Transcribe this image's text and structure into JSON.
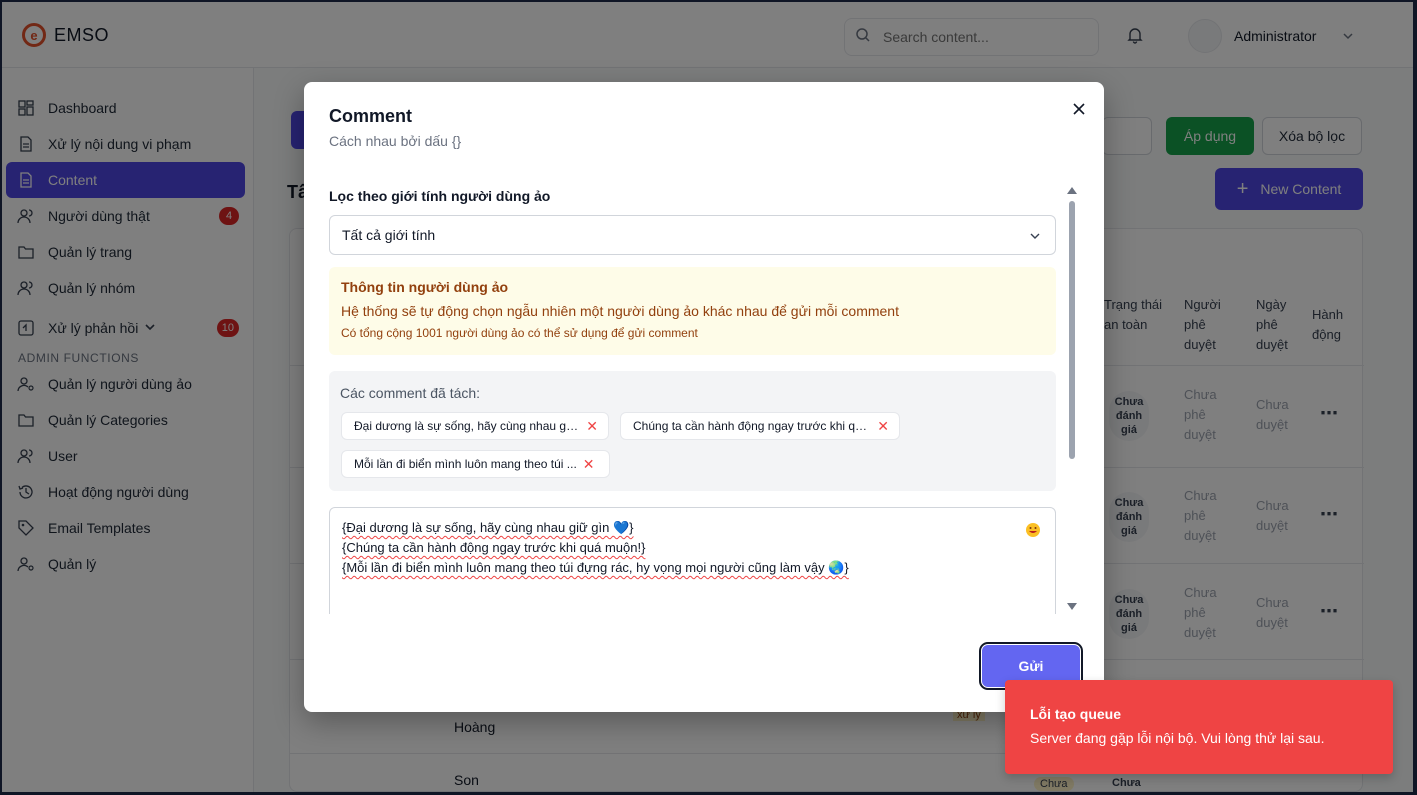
{
  "app": {
    "brand": "EMSO",
    "brand_color": "#e4502a"
  },
  "header": {
    "search_placeholder": "Search content...",
    "user_name": "Administrator"
  },
  "sidebar": {
    "items": [
      {
        "label": "Dashboard",
        "icon": "grid-icon"
      },
      {
        "label": "Xử lý nội dung vi phạm",
        "icon": "document-icon"
      },
      {
        "label": "Content",
        "icon": "document-icon",
        "active": true
      },
      {
        "label": "Người dùng thật",
        "icon": "users-icon",
        "badge": "4"
      },
      {
        "label": "Quản lý trang",
        "icon": "folder-icon"
      },
      {
        "label": "Quản lý nhóm",
        "icon": "users-icon"
      },
      {
        "label": "Xử lý phản hồi",
        "icon": "plus-square-icon",
        "badge": "10"
      }
    ],
    "section_label": "ADMIN FUNCTIONS",
    "admin_items": [
      {
        "label": "Quản lý người dùng ảo",
        "icon": "user-cog-icon"
      },
      {
        "label": "Quản lý Categories",
        "icon": "folder-icon"
      },
      {
        "label": "User",
        "icon": "users-icon"
      },
      {
        "label": "Hoạt động người dùng",
        "icon": "history-icon"
      },
      {
        "label": "Email Templates",
        "icon": "tag-icon"
      },
      {
        "label": "Quản lý",
        "icon": "user-cog-icon"
      }
    ],
    "accent": "#4f46e5"
  },
  "background": {
    "title_partial": "Tấ",
    "apply_label": "Áp dụng",
    "clear_label": "Xóa bộ lọc",
    "new_content_label": "New Content",
    "columns": [
      "Trạng thái an toàn",
      "Người phê duyệt",
      "Ngày phê duyệt",
      "Hành động"
    ],
    "pill_label": "Chưa đánh giá",
    "approver_label": "Chưa phê duyệt",
    "date_label": "Chưa duyệt",
    "row_names": [
      "Hoàng",
      "Son"
    ],
    "partial_tag": "xử lý",
    "partial_pill": "Chưa"
  },
  "modal": {
    "title": "Comment",
    "subtitle": "Cách nhau bởi dấu {}",
    "gender_label": "Lọc theo giới tính người dùng ảo",
    "gender_value": "Tất cả giới tính",
    "info_title": "Thông tin người dùng ảo",
    "info_line1": "Hệ thống sẽ tự động chọn ngẫu nhiên một người dùng ảo khác nhau để gửi mỗi comment",
    "info_line2": "Có tổng cộng 1001 người dùng ảo có thể sử dụng để gửi comment",
    "chips_label": "Các comment đã tách:",
    "chips": [
      "Đại dương là sự sống, hãy cùng nhau giữ ...",
      "Chúng ta cần hành động ngay trước khi qu...",
      "Mỗi lần đi biển mình luôn mang theo túi ..."
    ],
    "text_lines": [
      "{Đại dương là sự sống, hãy cùng nhau giữ gìn 💙}",
      "{Chúng ta cần hành động ngay trước khi quá muộn!}",
      "{Mỗi lần đi biển mình luôn mang theo túi đựng rác, hy vọng mọi người cũng làm vậy 🌏}"
    ],
    "send_label": "Gửi"
  },
  "toast": {
    "title": "Lỗi tạo queue",
    "message": "Server đang gặp lỗi nội bộ. Vui lòng thử lại sau.",
    "color": "#ef4444"
  }
}
